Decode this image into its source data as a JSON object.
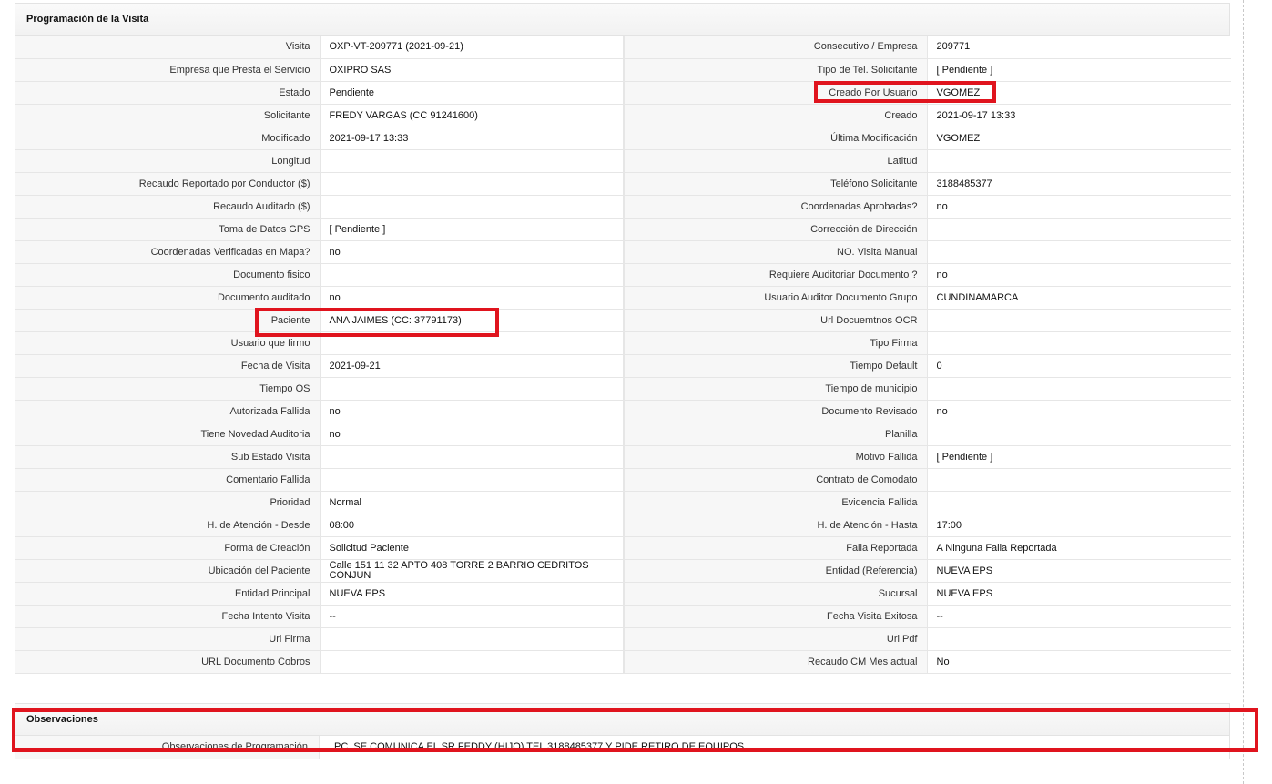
{
  "visita_panel": {
    "title": "Programación de la Visita",
    "rows": [
      {
        "l1": "Visita",
        "v1": "OXP-VT-209771 (2021-09-21)",
        "l2": "Consecutivo / Empresa",
        "v2": "209771"
      },
      {
        "l1": "Empresa que Presta el Servicio",
        "v1": "OXIPRO SAS",
        "l2": "Tipo de Tel. Solicitante",
        "v2": "[ Pendiente ]"
      },
      {
        "l1": "Estado",
        "v1": "Pendiente",
        "l2": "Creado Por Usuario",
        "v2": "VGOMEZ"
      },
      {
        "l1": "Solicitante",
        "v1": "FREDY VARGAS (CC 91241600)",
        "l2": "Creado",
        "v2": "2021-09-17 13:33"
      },
      {
        "l1": "Modificado",
        "v1": "2021-09-17 13:33",
        "l2": "Última Modificación",
        "v2": " VGOMEZ"
      },
      {
        "l1": "Longitud",
        "v1": "",
        "l2": "Latitud",
        "v2": ""
      },
      {
        "l1": "Recaudo Reportado por Conductor ($)",
        "v1": "",
        "l2": "Teléfono Solicitante",
        "v2": "3188485377"
      },
      {
        "l1": "Recaudo Auditado ($)",
        "v1": "",
        "l2": "Coordenadas Aprobadas?",
        "v2": " no"
      },
      {
        "l1": "Toma de Datos GPS",
        "v1": "[ Pendiente ]",
        "l2": "Corrección de Dirección",
        "v2": ""
      },
      {
        "l1": "Coordenadas Verificadas en Mapa?",
        "v1": " no",
        "l2": "NO. Visita Manual",
        "v2": ""
      },
      {
        "l1": "Documento fisico",
        "v1": "",
        "l2": "Requiere Auditoriar Documento ?",
        "v2": " no"
      },
      {
        "l1": "Documento auditado",
        "v1": " no",
        "l2": "Usuario Auditor Documento Grupo",
        "v2": "CUNDINAMARCA"
      },
      {
        "l1": "Paciente",
        "v1": "ANA JAIMES (CC: 37791173)",
        "l2": "Url Docuemtnos OCR",
        "v2": ""
      },
      {
        "l1": "Usuario que firmo",
        "v1": "",
        "l2": "Tipo Firma",
        "v2": ""
      },
      {
        "l1": "Fecha de Visita",
        "v1": " 2021-09-21",
        "l2": "Tiempo Default",
        "v2": "0"
      },
      {
        "l1": "Tiempo OS",
        "v1": "",
        "l2": "Tiempo de municipio",
        "v2": ""
      },
      {
        "l1": "Autorizada Fallida",
        "v1": " no",
        "l2": "Documento Revisado",
        "v2": " no"
      },
      {
        "l1": "Tiene Novedad Auditoria",
        "v1": " no",
        "l2": "Planilla",
        "v2": ""
      },
      {
        "l1": "Sub Estado Visita",
        "v1": "",
        "l2": "Motivo Fallida",
        "v2": "[ Pendiente ]"
      },
      {
        "l1": "Comentario Fallida",
        "v1": "",
        "l2": "Contrato de Comodato",
        "v2": ""
      },
      {
        "l1": "Prioridad",
        "v1": "Normal",
        "l2": "Evidencia Fallida",
        "v2": ""
      },
      {
        "l1": "H. de Atención - Desde",
        "v1": "08:00",
        "l2": "H. de Atención - Hasta",
        "v2": "17:00"
      },
      {
        "l1": "Forma de Creación",
        "v1": "Solicitud Paciente",
        "l2": "Falla Reportada",
        "v2": "A Ninguna Falla Reportada"
      },
      {
        "l1": "Ubicación del Paciente",
        "v1": "Calle 151 11 32 APTO 408 TORRE 2 BARRIO CEDRITOS CONJUN",
        "l2": "Entidad (Referencia)",
        "v2": "NUEVA EPS"
      },
      {
        "l1": "Entidad Principal",
        "v1": "NUEVA EPS",
        "l2": "Sucursal",
        "v2": "NUEVA EPS"
      },
      {
        "l1": "Fecha Intento Visita",
        "v1": " --",
        "l2": "Fecha Visita Exitosa",
        "v2": " --"
      },
      {
        "l1": "Url Firma",
        "v1": "",
        "l2": "Url Pdf",
        "v2": ""
      },
      {
        "l1": "URL Documento Cobros",
        "v1": "",
        "l2": "Recaudo CM Mes actual",
        "v2": " No"
      }
    ]
  },
  "observaciones_panel": {
    "title": "Observaciones",
    "label": "Observaciones de Programación",
    "value": "PC. SE COMUNICA EL SR FEDDY (HIJO) TEL 3188485377 Y PIDE RETIRO DE EQUIPOS"
  },
  "highlight_color": "#e0141e"
}
